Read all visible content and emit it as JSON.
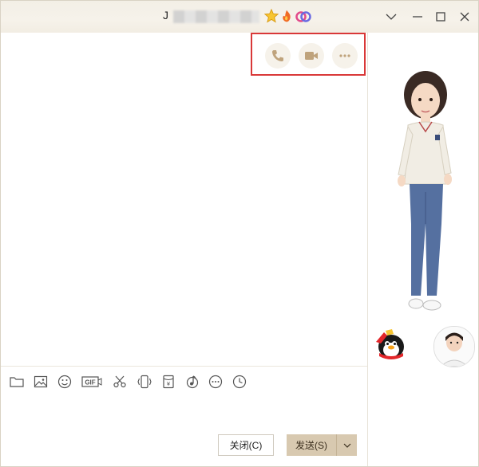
{
  "window": {
    "title_prefix": "J",
    "title_masked": true
  },
  "top_actions": [
    {
      "name": "voice-call-icon"
    },
    {
      "name": "video-call-icon"
    },
    {
      "name": "more-icon"
    }
  ],
  "toolbar": [
    {
      "name": "folder-icon"
    },
    {
      "name": "image-icon"
    },
    {
      "name": "emoji-icon"
    },
    {
      "name": "gif-icon",
      "label": "GIF"
    },
    {
      "name": "scissors-icon"
    },
    {
      "name": "shake-icon"
    },
    {
      "name": "red-packet-icon",
      "label": "¥"
    },
    {
      "name": "music-icon"
    },
    {
      "name": "more-options-icon"
    },
    {
      "name": "history-clock-icon"
    }
  ],
  "buttons": {
    "close_label": "关闭(C)",
    "send_label": "发送(S)"
  },
  "colors": {
    "titlebar_bg": "#f3efe6",
    "send_bg": "#d8c9b0",
    "highlight": "#d93838",
    "icon_accent": "#c4a985"
  }
}
